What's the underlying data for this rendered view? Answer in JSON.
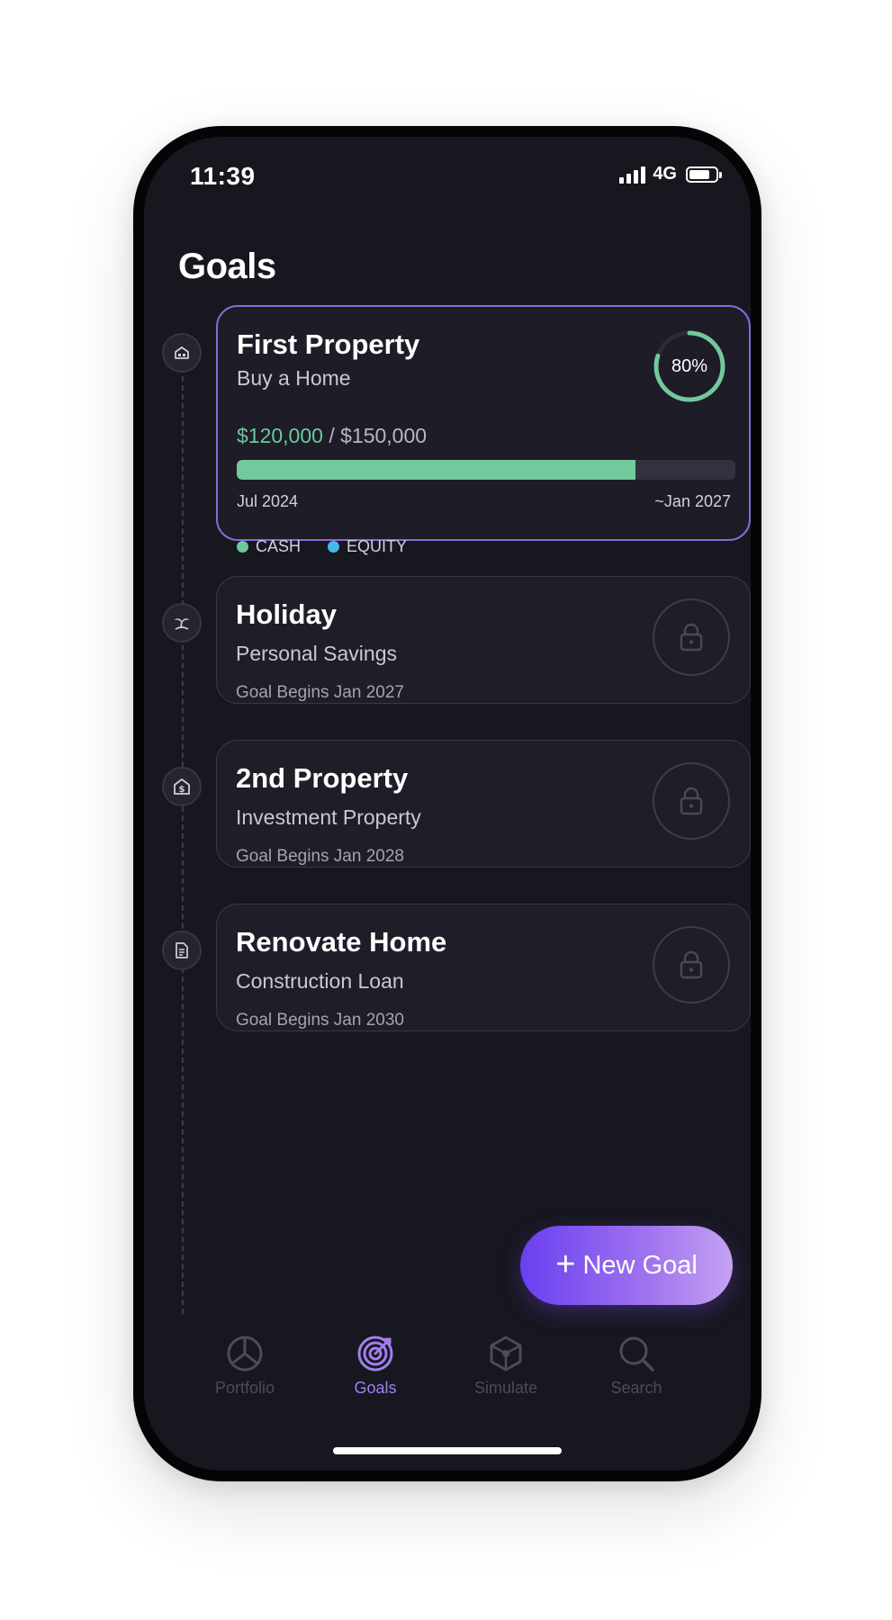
{
  "status_bar": {
    "time": "11:39",
    "network": "4G",
    "battery_level": 0.8
  },
  "header": {
    "title": "Goals"
  },
  "goals": [
    {
      "title": "First Property",
      "subtitle": "Buy a Home",
      "icon": "house-icon",
      "active": true,
      "progress_label": "80%",
      "progress_fraction": 0.8,
      "amount_current": "$120,000",
      "amount_separator": " / ",
      "amount_target": "$150,000",
      "date_start": "Jul 2024",
      "date_end": "~Jan 2027",
      "legend": [
        {
          "label": "CASH",
          "color": "#6cc99a"
        },
        {
          "label": "EQUITY",
          "color": "#45b9e6"
        }
      ]
    },
    {
      "title": "Holiday",
      "subtitle": "Personal Savings",
      "begins": "Goal Begins Jan 2027",
      "icon": "island-icon",
      "locked": true
    },
    {
      "title": "2nd Property",
      "subtitle": "Investment Property",
      "begins": "Goal Begins Jan 2028",
      "icon": "dollar-house-icon",
      "locked": true
    },
    {
      "title": "Renovate Home",
      "subtitle": "Construction Loan",
      "begins": "Goal Begins Jan 2030",
      "icon": "document-icon",
      "locked": true
    }
  ],
  "new_goal_button": {
    "label": "New Goal"
  },
  "tabs": [
    {
      "label": "Portfolio",
      "icon": "pie-chart-icon",
      "active": false
    },
    {
      "label": "Goals",
      "icon": "target-icon",
      "active": true
    },
    {
      "label": "Simulate",
      "icon": "cube-icon",
      "active": false
    },
    {
      "label": "Search",
      "icon": "search-icon",
      "active": false
    }
  ],
  "colors": {
    "accent": "#9b72ef",
    "progress": "#72c99b",
    "background": "#17171f"
  }
}
